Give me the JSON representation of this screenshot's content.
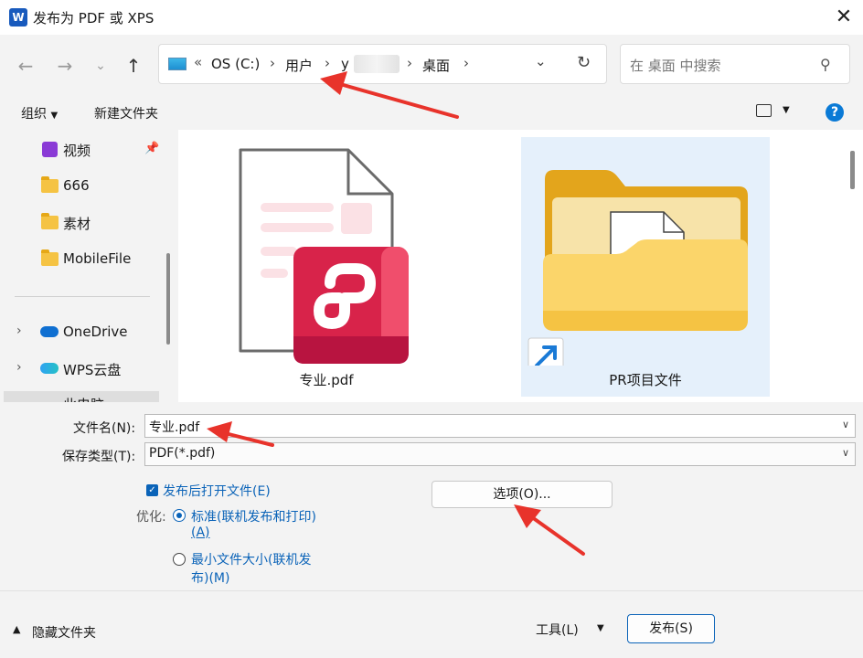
{
  "window": {
    "title": "发布为 PDF 或 XPS",
    "app_icon": "W"
  },
  "address": {
    "overflow": "«",
    "path": [
      "OS (C:)",
      "用户",
      "y",
      "桌面"
    ]
  },
  "search": {
    "placeholder": "在 桌面 中搜索"
  },
  "toolbar": {
    "organize": "组织",
    "new_folder": "新建文件夹"
  },
  "sidebar": {
    "items": [
      {
        "label": "视频",
        "icon": "video-icon"
      },
      {
        "label": "666",
        "icon": "folder-icon"
      },
      {
        "label": "素材",
        "icon": "folder-icon"
      },
      {
        "label": "MobileFile",
        "icon": "folder-icon"
      },
      {
        "label": "OneDrive",
        "icon": "cloud-icon"
      },
      {
        "label": "WPS云盘",
        "icon": "cloud-icon"
      },
      {
        "label": "此电脑",
        "icon": "pc-icon"
      }
    ]
  },
  "files": [
    {
      "name": "专业.pdf",
      "icon": "pdf-icon"
    },
    {
      "name": "PR项目文件",
      "icon": "folder-shortcut-icon"
    }
  ],
  "form": {
    "filename_label": "文件名(N):",
    "filename_value": "专业.pdf",
    "filetype_label": "保存类型(T):",
    "filetype_value": "PDF(*.pdf)",
    "open_after": "发布后打开文件(E)",
    "optimize_label": "优化:",
    "opt_standard_1": "标准(联机发布和打印)",
    "opt_standard_2": "(A)",
    "opt_min_1": "最小文件大小(联机发",
    "opt_min_2": "布)(M)",
    "options_button": "选项(O)..."
  },
  "footer": {
    "hide_folders": "隐藏文件夹",
    "tools": "工具(L)",
    "publish": "发布(S)"
  },
  "colors": {
    "accent": "#0a63b8",
    "annotation_arrow": "#e8332b",
    "pdf_red": "#d8234a",
    "folder_yellow": "#f5c343"
  }
}
